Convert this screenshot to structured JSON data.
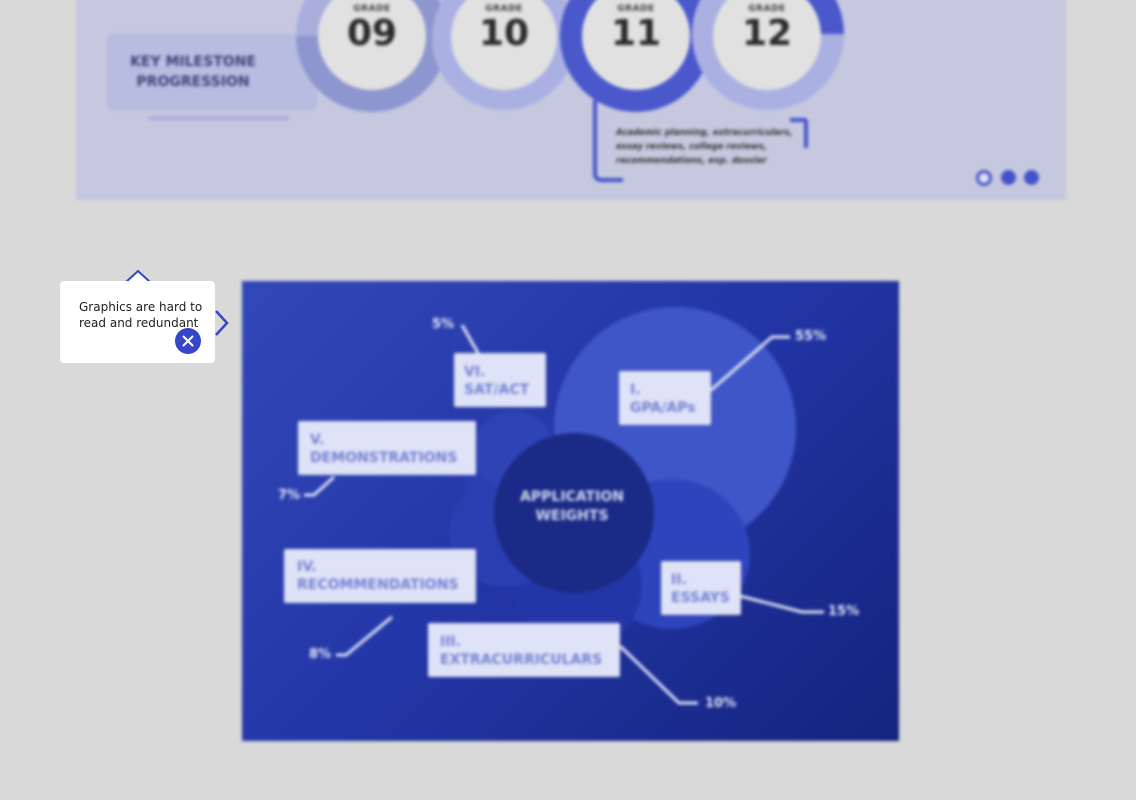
{
  "milestone_slide": {
    "title": "KEY MILESTONE PROGRESSION",
    "grades": [
      {
        "label": "GRADE",
        "number": "09"
      },
      {
        "label": "GRADE",
        "number": "10"
      },
      {
        "label": "GRADE",
        "number": "11"
      },
      {
        "label": "GRADE",
        "number": "12"
      }
    ],
    "grade11_note": "Academic planning, extracurriculars, essay reviews, college reviews, recommendations, exp. dossier",
    "pager": {
      "pages": 3,
      "current": 1
    }
  },
  "infographic": {
    "center_title": "APPLICATION WEIGHTS",
    "items": [
      {
        "numeral": "I.",
        "name": "GPA/APs",
        "percent": "55%"
      },
      {
        "numeral": "II.",
        "name": "ESSAYS",
        "percent": "15%"
      },
      {
        "numeral": "III.",
        "name": "EXTRACURRICULARS",
        "percent": "10%"
      },
      {
        "numeral": "IV.",
        "name": "RECOMMENDATIONS",
        "percent": "8%"
      },
      {
        "numeral": "V.",
        "name": "DEMONSTRATIONS",
        "percent": "7%"
      },
      {
        "numeral": "VI.",
        "name": "SAT/ACT",
        "percent": "5%"
      }
    ]
  },
  "tooltip": {
    "text": "Graphics are hard to read and redundant",
    "close_icon": "close-icon",
    "accent": "#3547c6"
  },
  "colors": {
    "background": "#d9d9d9",
    "accent": "#4452c9",
    "infographic_bg": "#2437a8"
  }
}
